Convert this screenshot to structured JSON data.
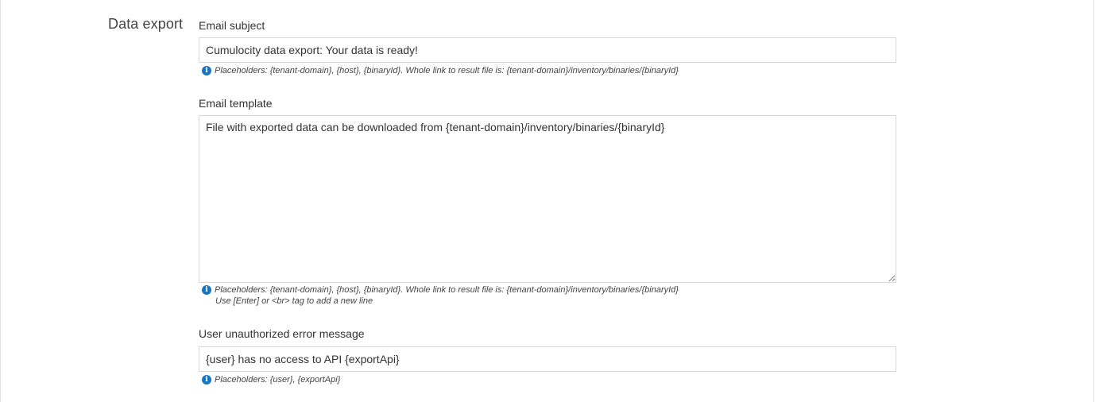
{
  "section": {
    "title": "Data export"
  },
  "email_subject": {
    "label": "Email subject",
    "value": "Cumulocity data export: Your data is ready!",
    "help": "Placeholders: {tenant-domain}, {host}, {binaryId}. Whole link to result file is: {tenant-domain}/inventory/binaries/{binaryId}"
  },
  "email_template": {
    "label": "Email template",
    "value": "File with exported data can be downloaded from {tenant-domain}/inventory/binaries/{binaryId}",
    "help_line1": "Placeholders: {tenant-domain}, {host}, {binaryId}. Whole link to result file is: {tenant-domain}/inventory/binaries/{binaryId}",
    "help_line2": "Use [Enter] or <br> tag to add a new line"
  },
  "unauthorized_message": {
    "label": "User unauthorized error message",
    "value": "{user} has no access to API {exportApi}",
    "help": "Placeholders: {user}, {exportApi}"
  },
  "icons": {
    "info": "info-circle-icon"
  },
  "colors": {
    "info_icon": "#1776bf",
    "border": "#d8d8d8"
  }
}
